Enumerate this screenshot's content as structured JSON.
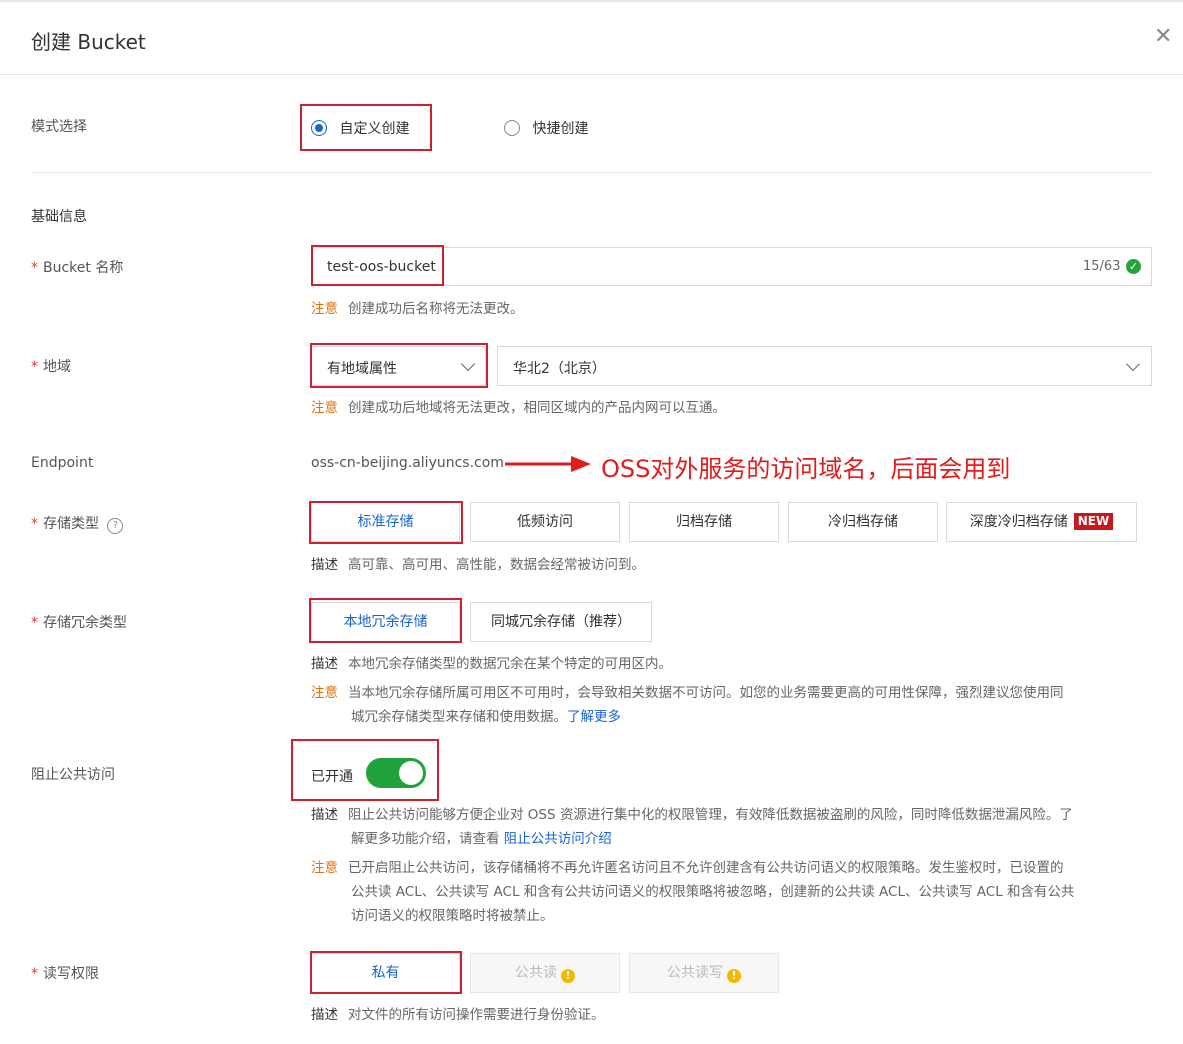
{
  "dialog": {
    "title": "创建 Bucket"
  },
  "mode": {
    "label": "模式选择",
    "options": [
      "自定义创建",
      "快捷创建"
    ],
    "selected": "自定义创建"
  },
  "basic": {
    "heading": "基础信息"
  },
  "bucket_name": {
    "label": "Bucket 名称",
    "value": "test-oos-bucket",
    "counter": "15/63",
    "note_key": "注意",
    "note": "创建成功后名称将无法更改。"
  },
  "region": {
    "label": "地域",
    "attr_value": "有地域属性",
    "region_value": "华北2（北京）",
    "note_key": "注意",
    "note": "创建成功后地域将无法更改，相同区域内的产品内网可以互通。"
  },
  "endpoint": {
    "label": "Endpoint",
    "value": "oss-cn-beijing.aliyuncs.com",
    "annotation": "OSS对外服务的访问域名，后面会用到"
  },
  "storage_class": {
    "label": "存储类型",
    "help_icon": "question-circle-icon",
    "options": [
      "标准存储",
      "低频访问",
      "归档存储",
      "冷归档存储",
      "深度冷归档存储"
    ],
    "new_badge": "NEW",
    "selected": "标准存储",
    "desc_key": "描述",
    "desc": "高可靠、高可用、高性能，数据会经常被访问到。"
  },
  "redundancy": {
    "label": "存储冗余类型",
    "options": [
      "本地冗余存储",
      "同城冗余存储（推荐）"
    ],
    "selected": "本地冗余存储",
    "desc_key": "描述",
    "desc": "本地冗余存储类型的数据冗余在某个特定的可用区内。",
    "note_key": "注意",
    "note_line1": "当本地冗余存储所属可用区不可用时，会导致相关数据不可访问。如您的业务需要更高的可用性保障，强烈建议您使用同",
    "note_line2": "城冗余存储类型来存储和使用数据。",
    "note_link": "了解更多"
  },
  "block_public": {
    "label": "阻止公共访问",
    "status": "已开通",
    "enabled": true,
    "desc_key": "描述",
    "desc_line1": "阻止公共访问能够方便企业对 OSS 资源进行集中化的权限管理，有效降低数据被盗刷的风险，同时降低数据泄漏风险。了",
    "desc_line2": "解更多功能介绍，请查看",
    "desc_link": "阻止公共访问介绍",
    "note_key": "注意",
    "note_line1": "已开启阻止公共访问，该存储桶将不再允许匿名访问且不允许创建含有公共访问语义的权限策略。发生鉴权时，已设置的",
    "note_line2": "公共读 ACL、公共读写 ACL 和含有公共访问语义的权限策略将被忽略，创建新的公共读 ACL、公共读写 ACL 和含有公共",
    "note_line3": "访问语义的权限策略时将被禁止。"
  },
  "acl": {
    "label": "读写权限",
    "options": [
      "私有",
      "公共读",
      "公共读写"
    ],
    "selected": "私有",
    "desc_key": "描述",
    "desc": "对文件的所有访问操作需要进行身份验证。"
  },
  "colors": {
    "accent": "#1b63d3",
    "annotation_red": "#d0202e",
    "toggle_green": "#1fa23c",
    "note_orange": "#e8710a"
  }
}
